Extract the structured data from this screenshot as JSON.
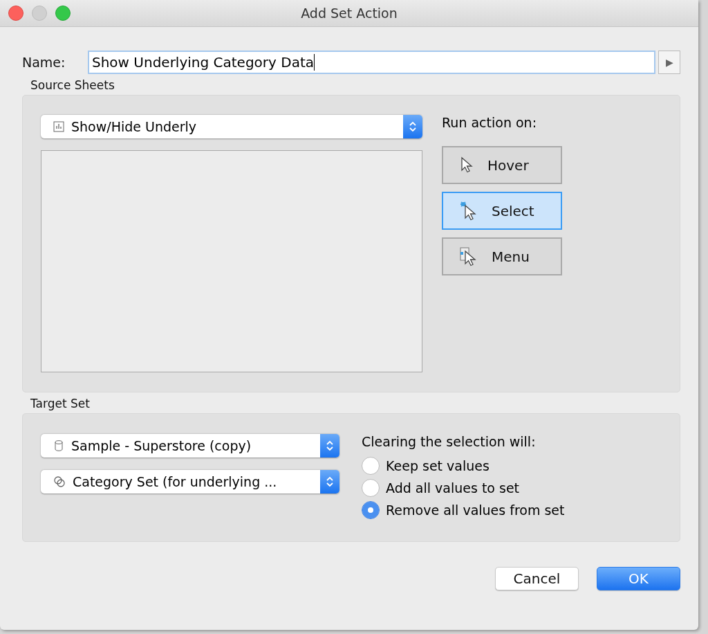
{
  "window": {
    "title": "Add Set Action"
  },
  "name_field": {
    "label": "Name:",
    "value": "Show Underlying Category Data",
    "menu_glyph": "▶"
  },
  "source_sheets": {
    "heading": "Source Sheets",
    "sheet_dropdown": {
      "value": "Show/Hide Underly"
    },
    "run_action_label": "Run action on:",
    "run_actions": [
      {
        "kind": "hover",
        "label": "Hover",
        "selected": false
      },
      {
        "kind": "select",
        "label": "Select",
        "selected": true
      },
      {
        "kind": "menu",
        "label": "Menu",
        "selected": false
      }
    ]
  },
  "target_set": {
    "heading": "Target Set",
    "dropdowns": [
      {
        "kind": "datasource",
        "value": "Sample - Superstore (copy)"
      },
      {
        "kind": "set",
        "value": "Category Set (for underlying ..."
      }
    ],
    "clearing_label": "Clearing the selection will:",
    "options": [
      {
        "label": "Keep set values",
        "selected": false
      },
      {
        "label": "Add all values to set",
        "selected": false
      },
      {
        "label": "Remove all values from set",
        "selected": true
      }
    ]
  },
  "buttons": [
    {
      "kind": "cancel",
      "label": "Cancel"
    },
    {
      "kind": "ok",
      "label": "OK"
    }
  ]
}
